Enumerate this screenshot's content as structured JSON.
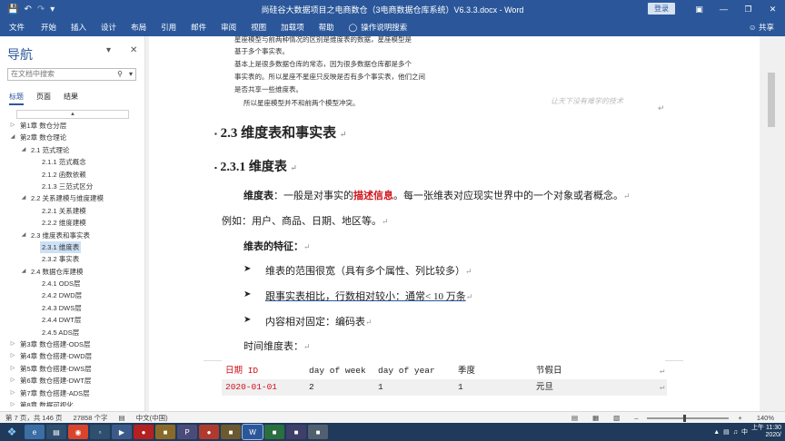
{
  "window": {
    "title": "尚硅谷大数据项目之电商数仓（3电商数据仓库系统）V6.3.3.docx  -  Word",
    "login_label": "登录"
  },
  "ribbon": {
    "tabs": [
      "文件",
      "开始",
      "插入",
      "设计",
      "布局",
      "引用",
      "邮件",
      "审阅",
      "视图",
      "加载项",
      "帮助"
    ],
    "tell_me": "操作说明搜索",
    "share": "共享"
  },
  "nav": {
    "title": "导航",
    "search_placeholder": "在文档中搜索",
    "tabs": [
      "标题",
      "页面",
      "结果"
    ],
    "tree": [
      {
        "label": "第1章 数仓分层",
        "level": 0,
        "arrow": "▷"
      },
      {
        "label": "第2章 数仓理论",
        "level": 0,
        "arrow": "◢"
      },
      {
        "label": "2.1 范式理论",
        "level": 1,
        "arrow": "◢"
      },
      {
        "label": "2.1.1 范式概念",
        "level": 2,
        "arrow": ""
      },
      {
        "label": "2.1.2 函数依赖",
        "level": 2,
        "arrow": ""
      },
      {
        "label": "2.1.3 三范式区分",
        "level": 2,
        "arrow": ""
      },
      {
        "label": "2.2 关系建模与维度建模",
        "level": 1,
        "arrow": "◢"
      },
      {
        "label": "2.2.1 关系建模",
        "level": 2,
        "arrow": ""
      },
      {
        "label": "2.2.2 维度建模",
        "level": 2,
        "arrow": ""
      },
      {
        "label": "2.3 维度表和事实表",
        "level": 1,
        "arrow": "◢"
      },
      {
        "label": "2.3.1 维度表",
        "level": 2,
        "arrow": "",
        "selected": true
      },
      {
        "label": "2.3.2 事实表",
        "level": 2,
        "arrow": ""
      },
      {
        "label": "2.4 数据仓库建模",
        "level": 1,
        "arrow": "◢"
      },
      {
        "label": "2.4.1 ODS层",
        "level": 2,
        "arrow": ""
      },
      {
        "label": "2.4.2 DWD层",
        "level": 2,
        "arrow": ""
      },
      {
        "label": "2.4.3 DWS层",
        "level": 2,
        "arrow": ""
      },
      {
        "label": "2.4.4 DWT层",
        "level": 2,
        "arrow": ""
      },
      {
        "label": "2.4.5 ADS层",
        "level": 2,
        "arrow": ""
      },
      {
        "label": "第3章 数仓搭建-ODS层",
        "level": 0,
        "arrow": "▷"
      },
      {
        "label": "第4章 数仓搭建-DWD层",
        "level": 0,
        "arrow": "▷"
      },
      {
        "label": "第5章 数仓搭建-DWS层",
        "level": 0,
        "arrow": "▷"
      },
      {
        "label": "第6章 数仓搭建-DWT层",
        "level": 0,
        "arrow": "▷"
      },
      {
        "label": "第7章 数仓搭建-ADS层",
        "level": 0,
        "arrow": "▷"
      },
      {
        "label": "第8章 数据可视化",
        "level": 0,
        "arrow": "▷"
      }
    ]
  },
  "doc": {
    "top_line1": "星座模型与前两种情况的区别是维度表的数据，星座模型是",
    "top_line2": "基于多个事实表。",
    "para1": "基本上是很多数据仓库的常态，因为很多数据仓库都是多个",
    "para2": "事实表的。所以星座不星座只反映是否有多个事实表，他们之间",
    "para3": "是否共享一些维度表。",
    "para4": "所以星座模型并不和前两个模型冲突。",
    "watermark": "让天下没有难学的技术",
    "h2": "2.3  维度表和事实表",
    "h3": "2.3.1  维度表",
    "def_label": "维度表",
    "def_text1": "：一般是对事实的",
    "def_red": "描述信息",
    "def_text2": "。每一张维表对应现实世界中的一个对象或者概念。",
    "example": "例如：用户、商品、日期、地区等。",
    "features_title": "维表的特征：",
    "bullets": [
      "维表的范围很宽（具有多个属性、列比较多）",
      "跟事实表相比，行数相对较小：通常< 10 万条",
      "内容相对固定：编码表"
    ],
    "time_title": "时间维度表：",
    "table_headers": [
      "日期 ID",
      "day of week",
      "day of year",
      "季度",
      "节假日"
    ],
    "table_row": [
      "2020-01-01",
      "2",
      "1",
      "1",
      "元旦"
    ]
  },
  "status": {
    "page": "第 7 页，共 146 页",
    "words": "27858 个字",
    "lang": "中文(中国)",
    "zoom": "140%"
  },
  "taskbar": {
    "time": "上午 11:30",
    "date": "2020/"
  }
}
